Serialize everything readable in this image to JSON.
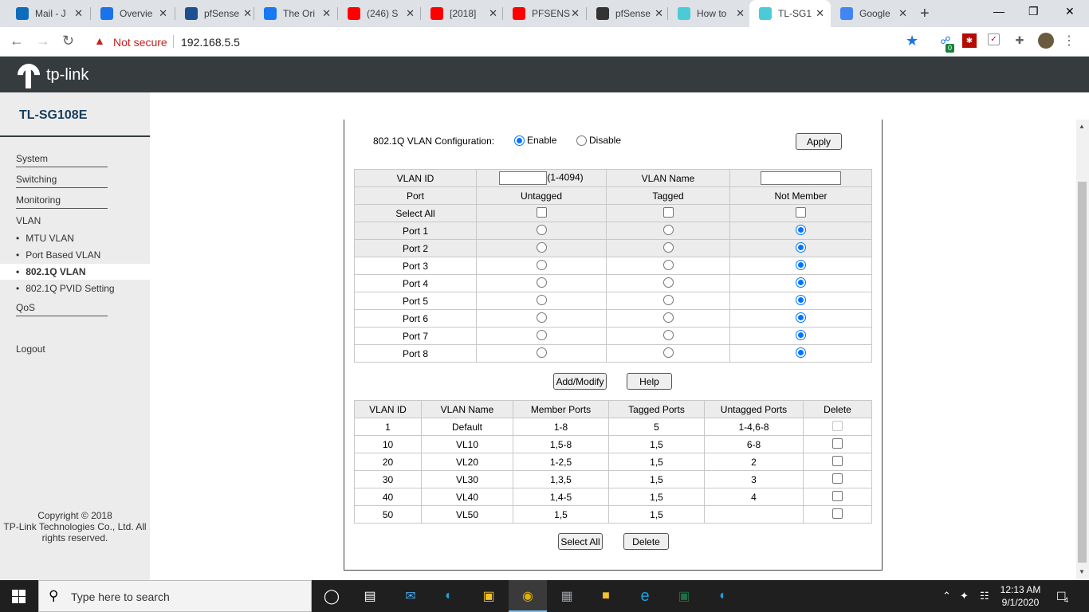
{
  "browser": {
    "tabs": [
      {
        "title": "Mail - J",
        "icon": "outlook-icon",
        "color": "#0f6cbd"
      },
      {
        "title": "Overvie",
        "icon": "shopping-bag-icon",
        "color": "#1a73e8"
      },
      {
        "title": "pfSense",
        "icon": "pfsense-icon",
        "color": "#1d4f91"
      },
      {
        "title": "The Ori",
        "icon": "facebook-icon",
        "color": "#1877f2"
      },
      {
        "title": "(246) S",
        "icon": "youtube-icon",
        "color": "#ff0000"
      },
      {
        "title": "[2018]",
        "icon": "youtube-icon",
        "color": "#ff0000"
      },
      {
        "title": "PFSENS",
        "icon": "youtube-icon",
        "color": "#ff0000"
      },
      {
        "title": "pfSense",
        "icon": "bolt-icon",
        "color": "#333333"
      },
      {
        "title": "How to",
        "icon": "tplink-icon",
        "color": "#4acbd6"
      },
      {
        "title": "TL-SG1",
        "icon": "tplink-icon",
        "color": "#4acbd6"
      },
      {
        "title": "Google",
        "icon": "google-icon",
        "color": "#4285f4"
      }
    ],
    "new_tab": "+",
    "not_secure": "Not secure",
    "url": "192.168.5.5",
    "ext_badge": "0"
  },
  "sidebar": {
    "model": "TL-SG108E",
    "menu": {
      "system": "System",
      "switching": "Switching",
      "monitoring": "Monitoring",
      "vlan": "VLAN",
      "mtu_vlan": "MTU VLAN",
      "port_based_vlan": "Port Based VLAN",
      "dot1q_vlan": "802.1Q VLAN",
      "pvid_setting": "802.1Q PVID Setting",
      "qos": "QoS",
      "logout": "Logout"
    },
    "copyright": {
      "line1": "Copyright © 2018",
      "line2": "TP-Link Technologies Co., Ltd. All",
      "line3": "rights reserved."
    }
  },
  "config": {
    "label": "802.1Q VLAN Configuration:",
    "enable": "Enable",
    "disable": "Disable",
    "enabled": true,
    "apply": "Apply"
  },
  "port_table": {
    "vlan_id_label": "VLAN ID",
    "vlan_id_value": "",
    "vlan_id_range": "(1-4094)",
    "vlan_name_label": "VLAN Name",
    "vlan_name_value": "",
    "headers": {
      "port": "Port",
      "untagged": "Untagged",
      "tagged": "Tagged",
      "not_member": "Not Member"
    },
    "select_all": "Select All",
    "ports": [
      {
        "name": "Port 1",
        "selected": "not_member"
      },
      {
        "name": "Port 2",
        "selected": "not_member"
      },
      {
        "name": "Port 3",
        "selected": "not_member"
      },
      {
        "name": "Port 4",
        "selected": "not_member"
      },
      {
        "name": "Port 5",
        "selected": "not_member"
      },
      {
        "name": "Port 6",
        "selected": "not_member"
      },
      {
        "name": "Port 7",
        "selected": "not_member"
      },
      {
        "name": "Port 8",
        "selected": "not_member"
      }
    ],
    "add_modify": "Add/Modify",
    "help": "Help"
  },
  "vlan_table": {
    "headers": {
      "id": "VLAN ID",
      "name": "VLAN Name",
      "members": "Member Ports",
      "tagged": "Tagged Ports",
      "untagged": "Untagged Ports",
      "delete": "Delete"
    },
    "rows": [
      {
        "id": "1",
        "name": "Default",
        "members": "1-8",
        "tagged": "5",
        "untagged": "1-4,6-8",
        "deletable": false
      },
      {
        "id": "10",
        "name": "VL10",
        "members": "1,5-8",
        "tagged": "1,5",
        "untagged": "6-8",
        "deletable": true
      },
      {
        "id": "20",
        "name": "VL20",
        "members": "1-2,5",
        "tagged": "1,5",
        "untagged": "2",
        "deletable": true
      },
      {
        "id": "30",
        "name": "VL30",
        "members": "1,3,5",
        "tagged": "1,5",
        "untagged": "3",
        "deletable": true
      },
      {
        "id": "40",
        "name": "VL40",
        "members": "1,4-5",
        "tagged": "1,5",
        "untagged": "4",
        "deletable": true
      },
      {
        "id": "50",
        "name": "VL50",
        "members": "1,5",
        "tagged": "1,5",
        "untagged": "",
        "deletable": true
      }
    ],
    "select_all": "Select All",
    "delete": "Delete"
  },
  "taskbar": {
    "search_placeholder": "Type here to search",
    "time": "12:13 AM",
    "date": "9/1/2020",
    "notification_count": "4"
  }
}
